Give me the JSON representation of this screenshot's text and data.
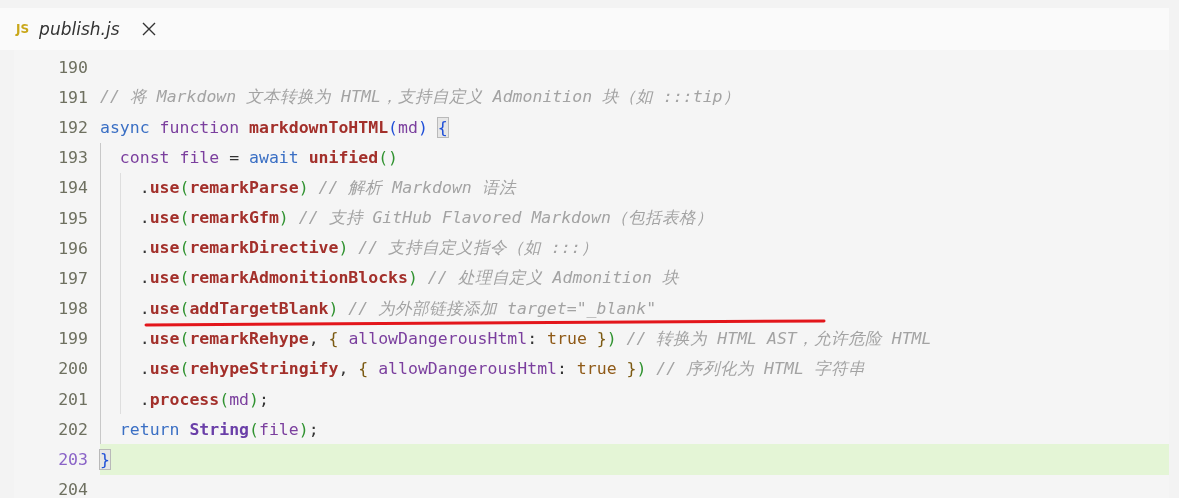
{
  "tab": {
    "badge": "JS",
    "filename": "publish.js",
    "preview": true
  },
  "lines": [
    {
      "number": "190",
      "current": false
    },
    {
      "number": "191",
      "current": false,
      "tokens": [
        {
          "kind": "comment",
          "text": "// 将 Markdown 文本转换为 HTML，支持自定义 Admonition 块（如 :::tip）"
        }
      ]
    },
    {
      "number": "192",
      "current": false,
      "tokens": [
        {
          "kind": "keyword",
          "text": "async"
        },
        {
          "kind": "storage",
          "text": " function"
        },
        {
          "kind": "function",
          "text": " markdownToHTML"
        },
        {
          "kind": "bracket1",
          "text": "("
        },
        {
          "kind": "variable",
          "text": "md"
        },
        {
          "kind": "bracket1",
          "text": ") "
        },
        {
          "kind": "bracket1",
          "text": "{",
          "matched": true
        }
      ]
    },
    {
      "number": "193",
      "current": false,
      "tokens": [
        {
          "kind": "storage",
          "text": "  const"
        },
        {
          "kind": "variable",
          "text": " file"
        },
        {
          "kind": "plain",
          "text": " = "
        },
        {
          "kind": "keyword",
          "text": "await"
        },
        {
          "kind": "function",
          "text": " unified"
        },
        {
          "kind": "bracket2",
          "text": "()"
        }
      ]
    },
    {
      "number": "194",
      "current": false,
      "tokens": [
        {
          "kind": "plain",
          "text": "    ."
        },
        {
          "kind": "function",
          "text": "use"
        },
        {
          "kind": "bracket2",
          "text": "("
        },
        {
          "kind": "function",
          "text": "remarkParse"
        },
        {
          "kind": "bracket2",
          "text": ")"
        },
        {
          "kind": "comment",
          "text": " // 解析 Markdown 语法"
        }
      ]
    },
    {
      "number": "195",
      "current": false,
      "tokens": [
        {
          "kind": "plain",
          "text": "    ."
        },
        {
          "kind": "function",
          "text": "use"
        },
        {
          "kind": "bracket2",
          "text": "("
        },
        {
          "kind": "function",
          "text": "remarkGfm"
        },
        {
          "kind": "bracket2",
          "text": ")"
        },
        {
          "kind": "comment",
          "text": " // 支持 GitHub Flavored Markdown（包括表格）"
        }
      ]
    },
    {
      "number": "196",
      "current": false,
      "tokens": [
        {
          "kind": "plain",
          "text": "    ."
        },
        {
          "kind": "function",
          "text": "use"
        },
        {
          "kind": "bracket2",
          "text": "("
        },
        {
          "kind": "function",
          "text": "remarkDirective"
        },
        {
          "kind": "bracket2",
          "text": ")"
        },
        {
          "kind": "comment",
          "text": " // 支持自定义指令（如 :::）"
        }
      ]
    },
    {
      "number": "197",
      "current": false,
      "tokens": [
        {
          "kind": "plain",
          "text": "    ."
        },
        {
          "kind": "function",
          "text": "use"
        },
        {
          "kind": "bracket2",
          "text": "("
        },
        {
          "kind": "function",
          "text": "remarkAdmonitionBlocks"
        },
        {
          "kind": "bracket2",
          "text": ")"
        },
        {
          "kind": "comment",
          "text": " // 处理自定义 Admonition 块"
        }
      ]
    },
    {
      "number": "198",
      "current": false,
      "underlined": true,
      "tokens": [
        {
          "kind": "plain",
          "text": "    ."
        },
        {
          "kind": "function",
          "text": "use"
        },
        {
          "kind": "bracket2",
          "text": "("
        },
        {
          "kind": "function",
          "text": "addTargetBlank"
        },
        {
          "kind": "bracket2",
          "text": ")"
        },
        {
          "kind": "comment",
          "text": " // 为外部链接添加 target=\"_blank\""
        }
      ]
    },
    {
      "number": "199",
      "current": false,
      "tokens": [
        {
          "kind": "plain",
          "text": "    ."
        },
        {
          "kind": "function",
          "text": "use"
        },
        {
          "kind": "bracket2",
          "text": "("
        },
        {
          "kind": "function",
          "text": "remarkRehype"
        },
        {
          "kind": "plain",
          "text": ","
        },
        {
          "kind": "bracket3",
          "text": " {"
        },
        {
          "kind": "variable",
          "text": " allowDangerousHtml"
        },
        {
          "kind": "plain",
          "text": ":"
        },
        {
          "kind": "constant",
          "text": " true"
        },
        {
          "kind": "bracket3",
          "text": " }"
        },
        {
          "kind": "bracket2",
          "text": ")"
        },
        {
          "kind": "comment",
          "text": " // 转换为 HTML AST，允许危险 HTML"
        }
      ]
    },
    {
      "number": "200",
      "current": false,
      "tokens": [
        {
          "kind": "plain",
          "text": "    ."
        },
        {
          "kind": "function",
          "text": "use"
        },
        {
          "kind": "bracket2",
          "text": "("
        },
        {
          "kind": "function",
          "text": "rehypeStringify"
        },
        {
          "kind": "plain",
          "text": ","
        },
        {
          "kind": "bracket3",
          "text": " {"
        },
        {
          "kind": "variable",
          "text": " allowDangerousHtml"
        },
        {
          "kind": "plain",
          "text": ":"
        },
        {
          "kind": "constant",
          "text": " true"
        },
        {
          "kind": "bracket3",
          "text": " }"
        },
        {
          "kind": "bracket2",
          "text": ")"
        },
        {
          "kind": "comment",
          "text": " // 序列化为 HTML 字符串"
        }
      ]
    },
    {
      "number": "201",
      "current": false,
      "tokens": [
        {
          "kind": "plain",
          "text": "    ."
        },
        {
          "kind": "function",
          "text": "process"
        },
        {
          "kind": "bracket2",
          "text": "("
        },
        {
          "kind": "variable",
          "text": "md"
        },
        {
          "kind": "bracket2",
          "text": ")"
        },
        {
          "kind": "plain",
          "text": ";"
        }
      ]
    },
    {
      "number": "202",
      "current": false,
      "tokens": [
        {
          "kind": "keyword",
          "text": "  return"
        },
        {
          "kind": "type",
          "text": " String"
        },
        {
          "kind": "bracket2",
          "text": "("
        },
        {
          "kind": "variable",
          "text": "file"
        },
        {
          "kind": "bracket2",
          "text": ")"
        },
        {
          "kind": "plain",
          "text": ";"
        }
      ]
    },
    {
      "number": "203",
      "current": true,
      "tokens": [
        {
          "kind": "bracket1",
          "text": "}",
          "matched": true
        }
      ]
    },
    {
      "number": "204",
      "current": false
    }
  ]
}
